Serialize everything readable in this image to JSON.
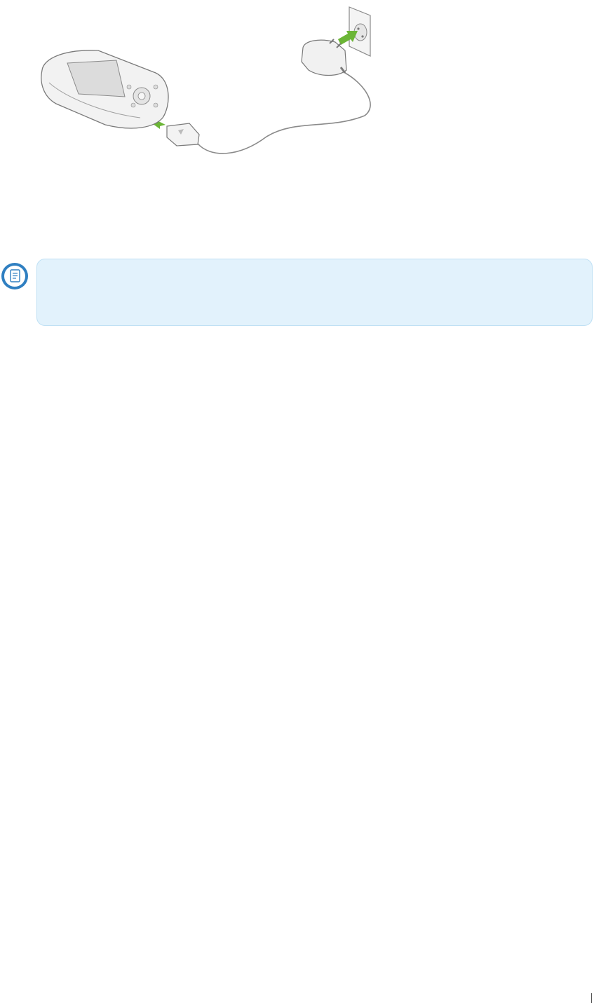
{
  "figure": {
    "subject": "device-charging-illustration",
    "arrow_color": "#6bb536",
    "line_color": "#7a7a7a"
  },
  "note": {
    "icon": "note-info-icon",
    "text": "",
    "background_color": "#e2f2fc",
    "border_color": "#bfe0f4",
    "icon_color": "#2f7fc1"
  }
}
